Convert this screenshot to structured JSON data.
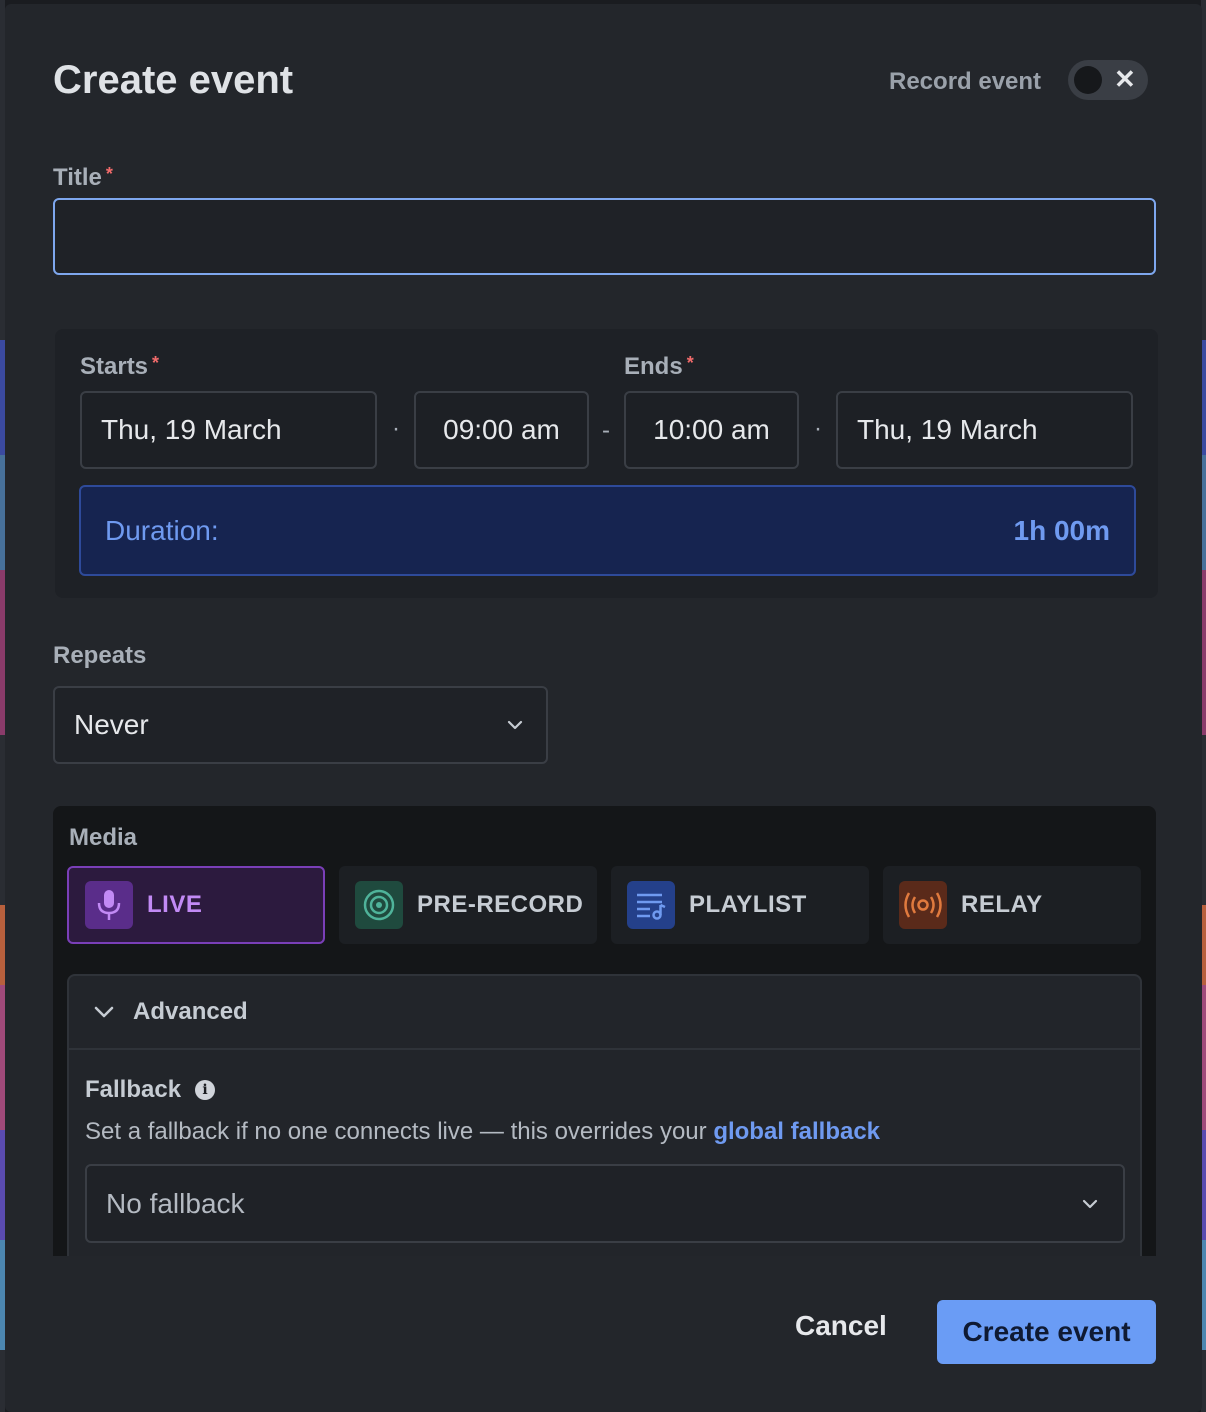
{
  "modal": {
    "title": "Create event",
    "record_label": "Record event",
    "record_toggle_state": "off"
  },
  "title_field": {
    "label": "Title",
    "required_mark": "*",
    "value": ""
  },
  "schedule": {
    "starts_label": "Starts",
    "ends_label": "Ends",
    "required_mark": "*",
    "start_date": "Thu, 19 March",
    "start_time": "09:00 am",
    "end_time": "10:00 am",
    "end_date": "Thu, 19 March",
    "dot_sep": "·",
    "dash_sep": "-",
    "duration_label": "Duration:",
    "duration_value": "1h 00m"
  },
  "repeats": {
    "label": "Repeats",
    "value": "Never"
  },
  "media": {
    "label": "Media",
    "options": [
      {
        "label": "LIVE",
        "icon": "microphone-icon",
        "color": "#c28af5",
        "active": true
      },
      {
        "label": "PRE-RECORD",
        "icon": "disc-icon",
        "color": "#4fb39a",
        "active": false
      },
      {
        "label": "PLAYLIST",
        "icon": "playlist-icon",
        "color": "#6f9af0",
        "active": false
      },
      {
        "label": "RELAY",
        "icon": "broadcast-icon",
        "color": "#e07a3e",
        "active": false
      }
    ]
  },
  "advanced": {
    "label": "Advanced",
    "fallback_title": "Fallback",
    "fallback_desc": "Set a fallback if no one connects live — this overrides your ",
    "fallback_link": "global fallback",
    "fallback_value": "No fallback"
  },
  "actions": {
    "cancel": "Cancel",
    "create": "Create event"
  }
}
